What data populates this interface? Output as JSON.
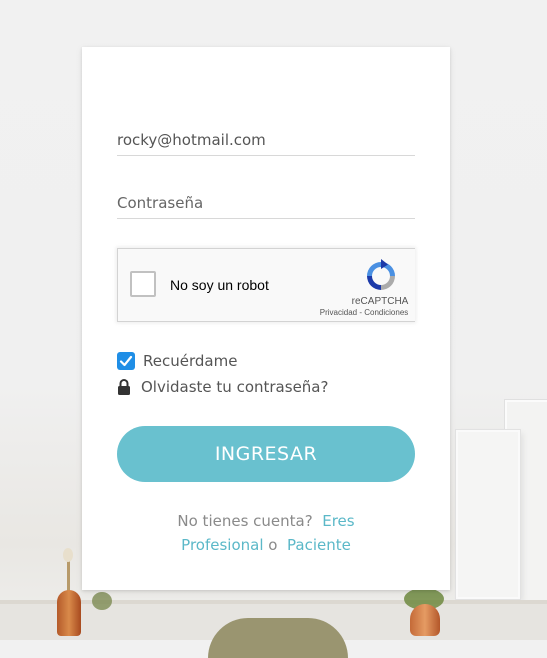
{
  "form": {
    "email_value": "rocky@hotmail.com",
    "password_placeholder": "Contraseña",
    "recaptcha": {
      "label": "No soy un robot",
      "brand": "reCAPTCHA",
      "privacy": "Privacidad",
      "separator": "-",
      "terms": "Condiciones"
    },
    "remember_label": "Recuérdame",
    "remember_checked": true,
    "forgot_label": "Olvidaste tu contraseña?",
    "submit_label": "INGRESAR"
  },
  "footer": {
    "prompt": "No tienes cuenta?",
    "professional_link": "Eres Profesional",
    "connector": "o",
    "patient_link": "Paciente"
  },
  "colors": {
    "accent": "#69c1cf",
    "link": "#5bb8c8",
    "checkbox": "#1f8ee6"
  }
}
